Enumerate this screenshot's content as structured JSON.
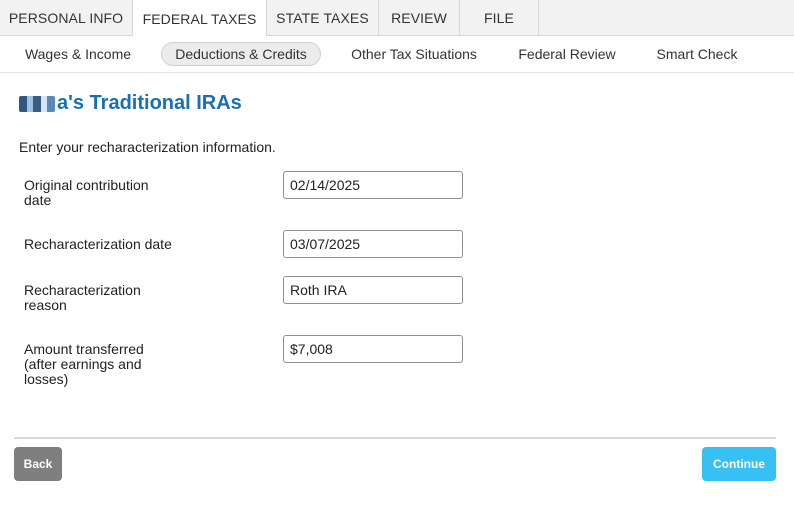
{
  "top_tabs": [
    {
      "label": "PERSONAL INFO",
      "active": false
    },
    {
      "label": "FEDERAL TAXES",
      "active": true
    },
    {
      "label": "STATE TAXES",
      "active": false
    },
    {
      "label": "REVIEW",
      "active": false
    },
    {
      "label": "FILE",
      "active": false
    }
  ],
  "sub_tabs": [
    {
      "label": "Wages & Income",
      "active": false
    },
    {
      "label": "Deductions & Credits",
      "active": true
    },
    {
      "label": "Other Tax Situations",
      "active": false
    },
    {
      "label": "Federal Review",
      "active": false
    },
    {
      "label": "Smart Check",
      "active": false
    }
  ],
  "page": {
    "title_suffix": "a's Traditional IRAs",
    "intro": "Enter your recharacterization information."
  },
  "form": {
    "original_contribution_date": {
      "label": "Original contribution date",
      "value": "02/14/2025"
    },
    "recharacterization_date": {
      "label": "Recharacterization date",
      "value": "03/07/2025"
    },
    "recharacterization_reason": {
      "label": "Recharacterization reason",
      "value": "Roth IRA"
    },
    "amount_transferred": {
      "label": "Amount transferred (after earnings and losses)",
      "value": "$7,008"
    }
  },
  "buttons": {
    "back": "Back",
    "continue": "Continue"
  },
  "colors": {
    "title": "#1a6fb3",
    "continue_button": "#36c0f4",
    "back_button": "#7f7f7f"
  }
}
